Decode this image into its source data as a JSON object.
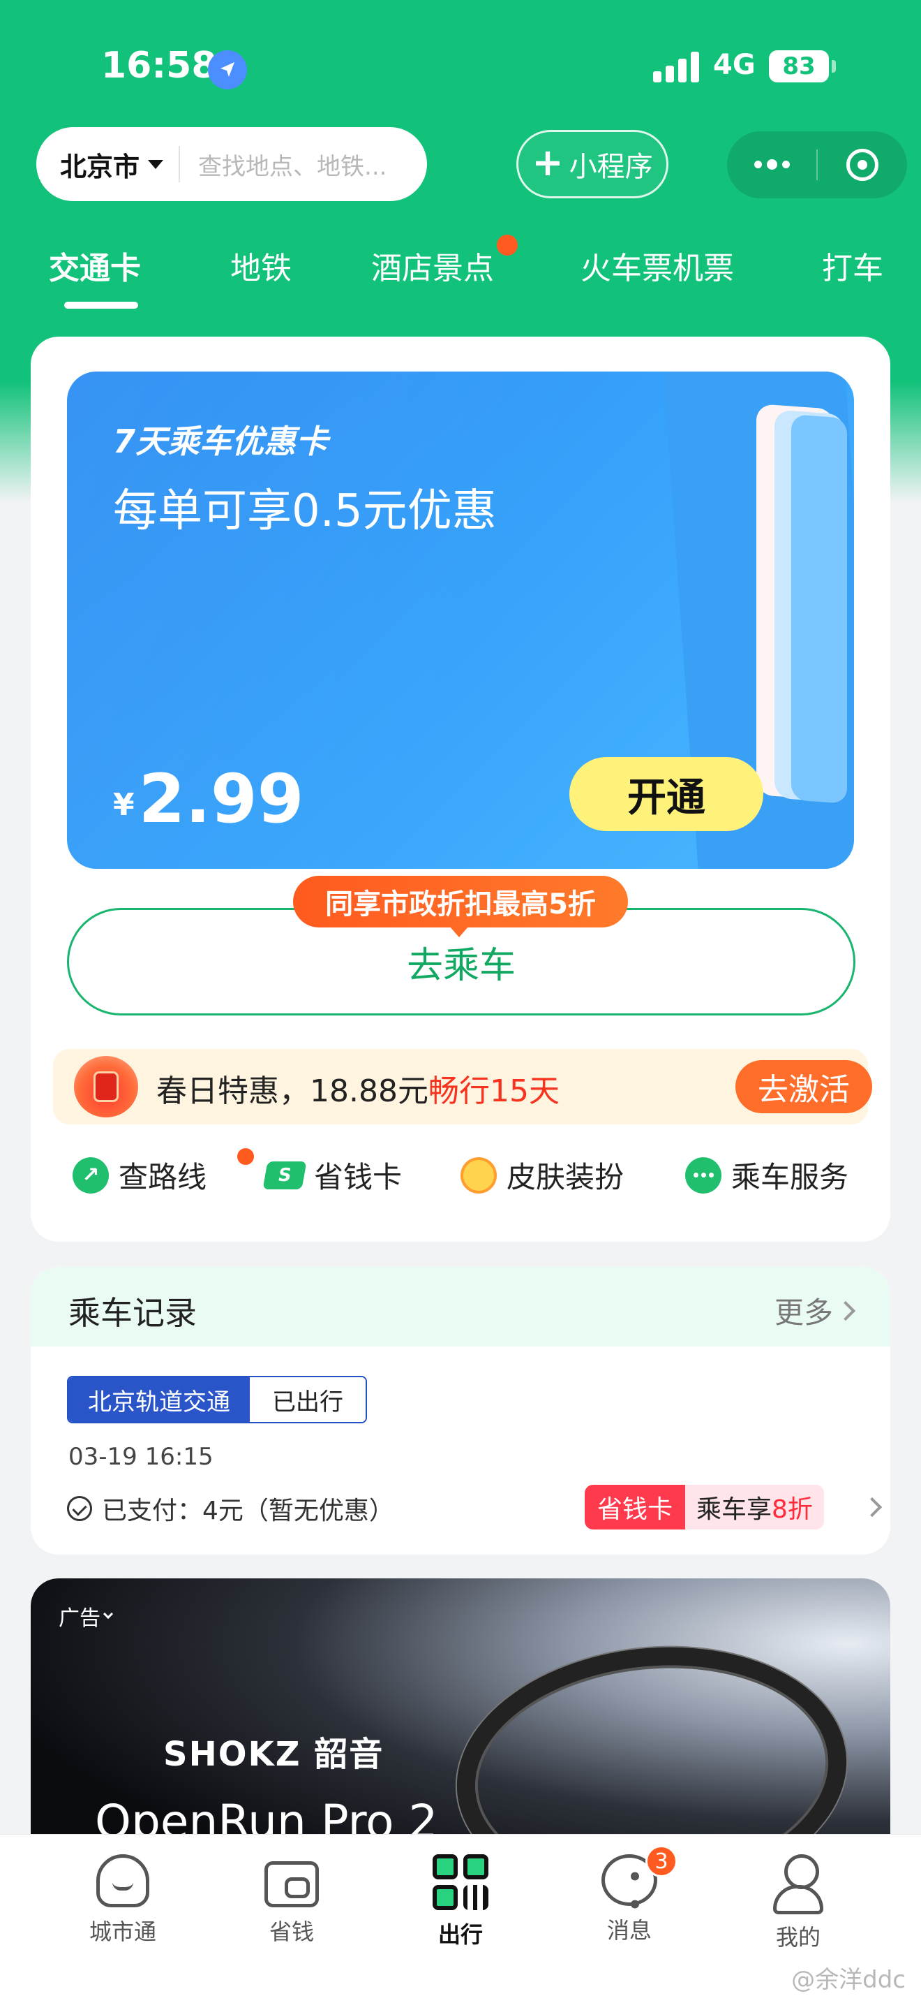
{
  "status": {
    "time": "16:58",
    "network": "4G",
    "battery": "83"
  },
  "header": {
    "city": "北京市",
    "search_placeholder": "查找地点、地铁...",
    "mini_program_label": "小程序"
  },
  "tabs": [
    {
      "label": "交通卡",
      "active": true
    },
    {
      "label": "地铁"
    },
    {
      "label": "酒店景点",
      "badge": true
    },
    {
      "label": "火车票机票"
    },
    {
      "label": "打车"
    }
  ],
  "promo": {
    "title": "7天乘车优惠卡",
    "subtitle": "每单可享0.5元优惠",
    "currency": "¥",
    "price": "2.99",
    "button": "开通"
  },
  "ride": {
    "tag": "同享市政折扣最高5折",
    "button": "去乘车"
  },
  "spring": {
    "text_plain": "春日特惠，18.88元",
    "text_highlight": "畅行15天",
    "button": "去激活"
  },
  "quick_links": [
    {
      "label": "查路线",
      "icon": "route-icon"
    },
    {
      "label": "省钱卡",
      "icon": "save-card-icon"
    },
    {
      "label": "皮肤装扮",
      "icon": "skin-icon"
    },
    {
      "label": "乘车服务",
      "icon": "service-icon"
    }
  ],
  "records": {
    "title": "乘车记录",
    "more": "更多",
    "line": "北京轨道交通",
    "state": "已出行",
    "datetime": "03-19 16:15",
    "paid": "已支付：4元（暂无优惠）",
    "save_tag": "省钱卡",
    "save_text_plain": "乘车享",
    "save_text_highlight": "8折"
  },
  "ad": {
    "label": "广告",
    "brand": "SHOKZ 韶音",
    "product": "OpenRun Pro 2"
  },
  "nav": [
    {
      "label": "城市通",
      "icon": "city-icon"
    },
    {
      "label": "省钱",
      "icon": "wallet-icon"
    },
    {
      "label": "出行",
      "icon": "travel-icon",
      "active": true
    },
    {
      "label": "消息",
      "icon": "message-icon",
      "badge": "3"
    },
    {
      "label": "我的",
      "icon": "profile-icon"
    }
  ],
  "watermark": "@余洋ddc",
  "colors": {
    "brand_green": "#13c27a",
    "accent_orange": "#ff5a1f",
    "promo_blue": "#38a4fb",
    "price_yellow": "#fff27a"
  }
}
